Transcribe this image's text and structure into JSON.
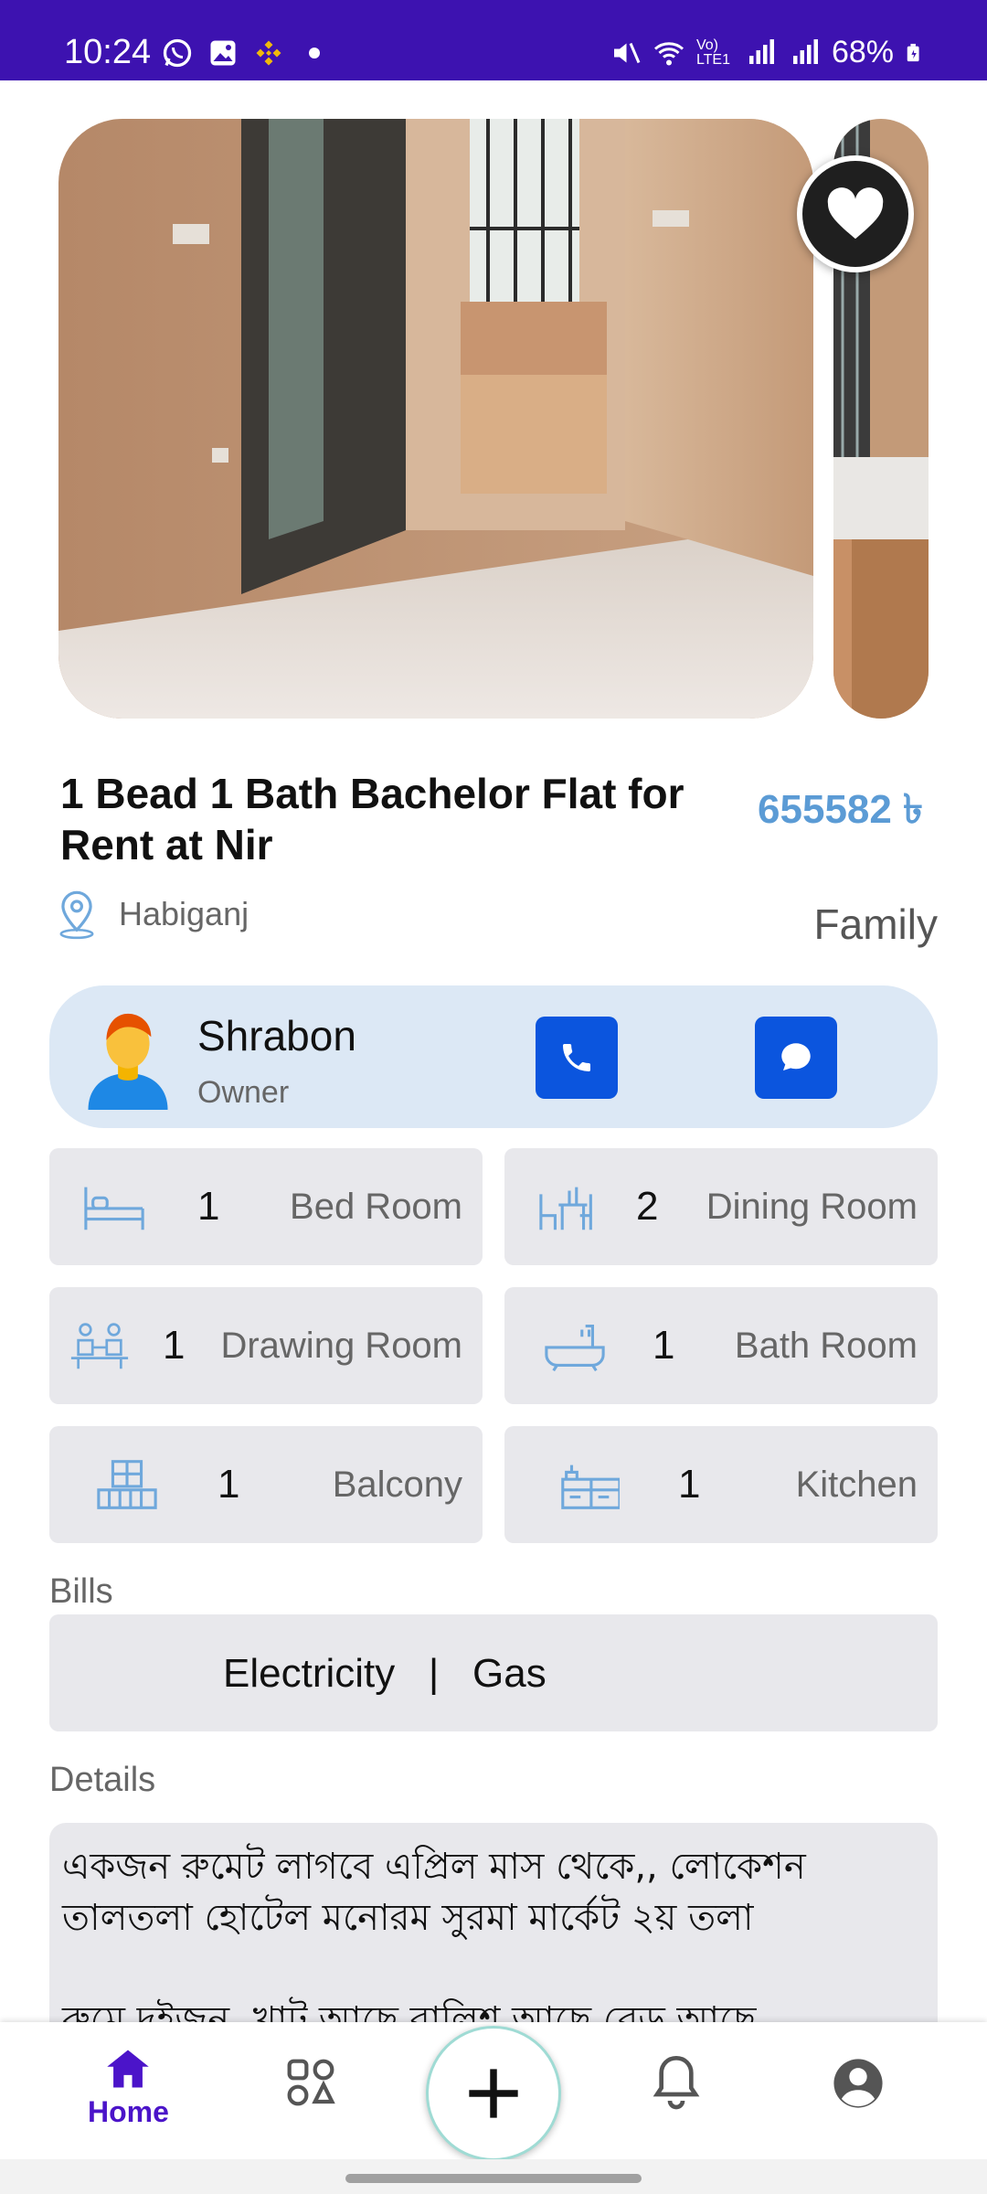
{
  "status_bar": {
    "time": "10:24",
    "battery": "68%",
    "network_label": "Vo) LTE1"
  },
  "listing": {
    "title": "1 Bead 1 Bath Bachelor Flat for Rent at Nir",
    "price": "655582 ৳",
    "location": "Habiganj",
    "tenant_type": "Family"
  },
  "owner": {
    "name": "Shrabon",
    "role": "Owner"
  },
  "rooms": [
    {
      "icon": "bed-icon",
      "count": "1",
      "label": "Bed Room"
    },
    {
      "icon": "dining-icon",
      "count": "2",
      "label": "Dining Room"
    },
    {
      "icon": "drawing-room-icon",
      "count": "1",
      "label": "Drawing Room"
    },
    {
      "icon": "bathtub-icon",
      "count": "1",
      "label": "Bath Room"
    },
    {
      "icon": "balcony-icon",
      "count": "1",
      "label": "Balcony"
    },
    {
      "icon": "kitchen-icon",
      "count": "1",
      "label": "Kitchen"
    }
  ],
  "bills": {
    "label": "Bills",
    "value": "Electricity   |   Gas"
  },
  "details": {
    "label": "Details",
    "text": "একজন রুমেট লাগবে এপ্রিল মাস থেকে,, লোকেশন তালতলা হোটেল মনোরম সুরমা মার্কেট ২য় তলা\n\nরুমে দুইজন, খাট আছে বালিশ আছে বেড আছে"
  },
  "nav": {
    "home_label": "Home"
  },
  "colors": {
    "status_bar": "#3d12b0",
    "accent": "#4b14c9",
    "price": "#5b9bd5",
    "call_button": "#0b55de"
  }
}
